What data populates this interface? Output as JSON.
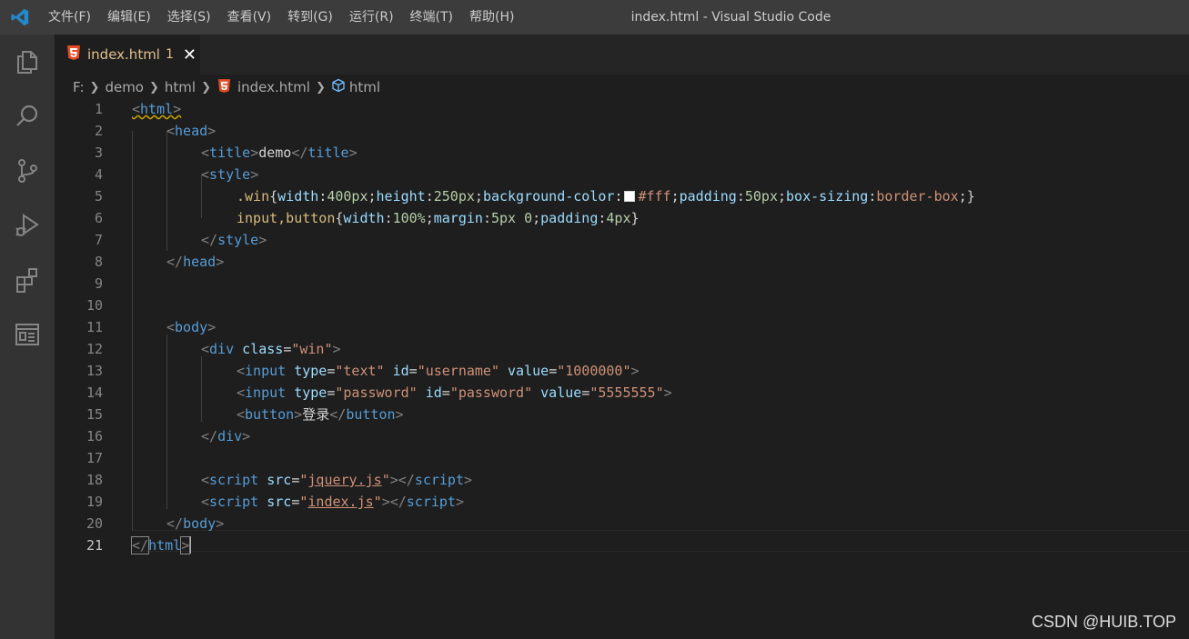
{
  "window": {
    "title": "index.html - Visual Studio Code"
  },
  "menu": [
    "文件(F)",
    "编辑(E)",
    "选择(S)",
    "查看(V)",
    "转到(G)",
    "运行(R)",
    "终端(T)",
    "帮助(H)"
  ],
  "activity_bar": [
    "explorer-icon",
    "search-icon",
    "source-control-icon",
    "run-debug-icon",
    "extensions-icon",
    "browser-preview-icon"
  ],
  "tab": {
    "name": "index.html",
    "badge": "1",
    "close": "✕",
    "icon": "html5-icon"
  },
  "breadcrumb": {
    "drive": "F:",
    "folder1": "demo",
    "folder2": "html",
    "file": "index.html",
    "symbol": "html"
  },
  "line_numbers": [
    "1",
    "2",
    "3",
    "4",
    "5",
    "6",
    "7",
    "8",
    "9",
    "10",
    "11",
    "12",
    "13",
    "14",
    "15",
    "16",
    "17",
    "18",
    "19",
    "20",
    "21"
  ],
  "active_line": "21",
  "code": {
    "l1": {
      "open": "<",
      "tag": "html",
      "close": ">"
    },
    "l2": {
      "open": "<",
      "tag": "head",
      "close": ">"
    },
    "l3": {
      "open": "<",
      "tag": "title",
      "close": ">",
      "text": "demo",
      "endopen": "</",
      "endtag": "title",
      "endclose": ">"
    },
    "l4": {
      "open": "<",
      "tag": "style",
      "close": ">"
    },
    "l5": {
      "selector": ".win",
      "b1": "{",
      "p1": "width",
      "c1": ":",
      "v1": "400px",
      "s1": ";",
      "p2": "height",
      "c2": ":",
      "v2": "250px",
      "s2": ";",
      "p3": "background-color",
      "c3": ":",
      "v3": "#fff",
      "s3": ";",
      "p4": "padding",
      "c4": ":",
      "v4": "50px",
      "s4": ";",
      "p5": "box-sizing",
      "c5": ":",
      "v5": "border-box",
      "s5": ";",
      "b2": "}"
    },
    "l6": {
      "selector": "input,button",
      "b1": "{",
      "p1": "width",
      "c1": ":",
      "v1": "100%",
      "s1": ";",
      "p2": "margin",
      "c2": ":",
      "v2": "5px 0",
      "s2": ";",
      "p3": "padding",
      "c3": ":",
      "v3": "4px",
      "b2": "}"
    },
    "l7": {
      "open": "</",
      "tag": "style",
      "close": ">"
    },
    "l8": {
      "open": "</",
      "tag": "head",
      "close": ">"
    },
    "l11": {
      "open": "<",
      "tag": "body",
      "close": ">"
    },
    "l12": {
      "open": "<",
      "tag": "div",
      "attr": "class",
      "eq": "=",
      "val": "\"win\"",
      "close": ">"
    },
    "l13": {
      "open": "<",
      "tag": "input",
      "a1": "type",
      "v1": "\"text\"",
      "a2": "id",
      "v2": "\"username\"",
      "a3": "value",
      "v3": "\"1000000\"",
      "eq": "=",
      "close": ">"
    },
    "l14": {
      "open": "<",
      "tag": "input",
      "a1": "type",
      "v1": "\"password\"",
      "a2": "id",
      "v2": "\"password\"",
      "a3": "value",
      "v3": "\"5555555\"",
      "eq": "=",
      "close": ">"
    },
    "l15": {
      "open": "<",
      "tag": "button",
      "close": ">",
      "text": "登录",
      "endopen": "</",
      "endtag": "button",
      "endclose": ">"
    },
    "l16": {
      "open": "</",
      "tag": "div",
      "close": ">"
    },
    "l18": {
      "open": "<",
      "tag": "script",
      "attr": "src",
      "eq": "=",
      "q1": "\"",
      "val": "jquery.js",
      "q2": "\"",
      "close": ">",
      "endopen": "</",
      "endtag": "script",
      "endclose": ">"
    },
    "l19": {
      "open": "<",
      "tag": "script",
      "attr": "src",
      "eq": "=",
      "q1": "\"",
      "val": "index.js",
      "q2": "\"",
      "close": ">",
      "endopen": "</",
      "endtag": "script",
      "endclose": ">"
    },
    "l20": {
      "open": "</",
      "tag": "body",
      "close": ">"
    },
    "l21": {
      "open": "</",
      "tag": "html",
      "close": ">"
    }
  },
  "watermark": "CSDN @HUIB.TOP"
}
